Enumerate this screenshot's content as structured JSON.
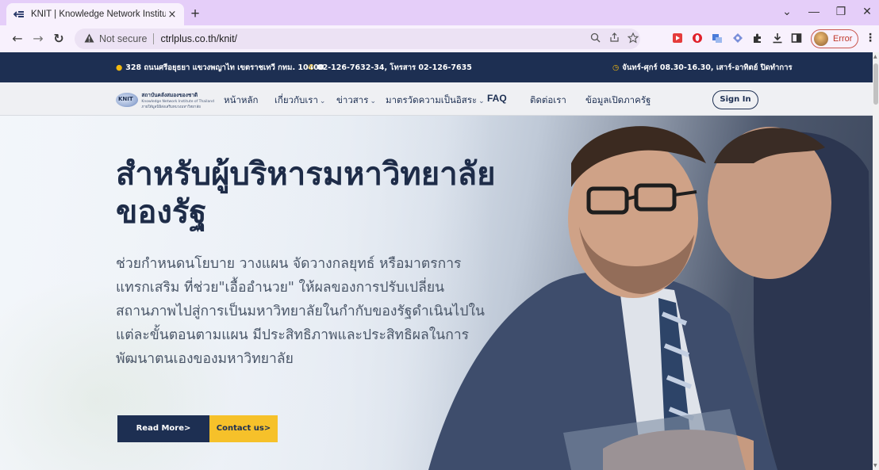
{
  "browser": {
    "tab_title": "KNIT | Knowledge Network Institute of Thailand",
    "tab_close": "×",
    "new_tab": "+",
    "url_warning": "Not secure",
    "url": "ctrlplus.co.th/knit/",
    "profile_status": "Error",
    "window_controls": {
      "dropdown": "⌄",
      "minimize": "—",
      "maximize": "❐",
      "close": "✕"
    },
    "nav": {
      "back": "←",
      "forward": "→",
      "reload": "↻"
    },
    "icons": [
      "zoom-icon",
      "share-icon",
      "bookmark-star-icon",
      "extension-icons",
      "download-icon",
      "sidebar-icon",
      "menu-icon"
    ]
  },
  "site": {
    "topbar": {
      "address": "328 ถนนศรีอยุธยา แขวงพญาไท เขตราชเทวี กทม. 10400",
      "phone": "02-126-7632-34, โทรสาร 02-126-7635",
      "hours": "จันทร์-ศุกร์ 08.30-16.30, เสาร์-อาทิตย์ ปิดทำการ"
    },
    "logo": {
      "mark": "KNIT",
      "line1": "สถาบันคลังสมองของชาติ",
      "line2": "Knowledge Network Institute of Thailand",
      "line3": "ภายใต้มูลนิธิส่งเสริมทบวงมหาวิทยาลัย"
    },
    "nav": {
      "home": "หน้าหลัก",
      "about": "เกี่ยวกับเรา",
      "news": "ข่าวสาร",
      "standards": "มาตรวัดความเป็นอิสระ",
      "faq": "FAQ",
      "contact": "ติดต่อเรา",
      "open_data": "ข้อมูลเปิดภาครัฐ",
      "signin": "Sign In"
    },
    "hero": {
      "title": "สำหรับผู้บริหารมหาวิทยาลัยของรัฐ",
      "description": "ช่วยกำหนดนโยบาย วางแผน จัดวางกลยุทธ์ หรือมาตรการแทรกเสริม ที่ช่วย\"เอื้ออำนวย\" ให้ผลของการปรับเปลี่ยนสถานภาพไปสู่การเป็นมหาวิทยาลัยในกำกับของรัฐดำเนินไปในแต่ละขั้นตอนตามแผน มีประสิทธิภาพและประสิทธิผลในการพัฒนาตนเองของมหาวิทยาลัย",
      "read_more": "Read More>",
      "contact_us": "Contact us>"
    }
  },
  "colors": {
    "navy": "#1d2f52",
    "yellow": "#f6c12a",
    "tabstrip": "#e5cef9"
  }
}
